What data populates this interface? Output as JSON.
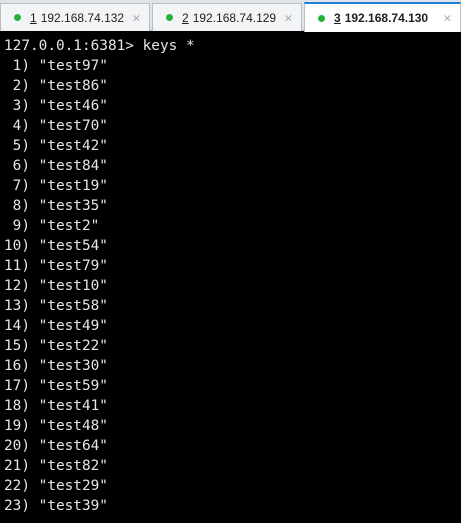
{
  "tabs": [
    {
      "number": "1",
      "label": "192.168.74.132",
      "status_color": "#22b33a",
      "active": false,
      "close": "×"
    },
    {
      "number": "2",
      "label": "192.168.74.129",
      "status_color": "#22b33a",
      "active": false,
      "close": "×"
    },
    {
      "number": "3",
      "label": "192.168.74.130",
      "status_color": "#22b33a",
      "active": true,
      "close": "×"
    }
  ],
  "terminal": {
    "prompt": "127.0.0.1:6381> keys *",
    "results": [
      " 1) \"test97\"",
      " 2) \"test86\"",
      " 3) \"test46\"",
      " 4) \"test70\"",
      " 5) \"test42\"",
      " 6) \"test84\"",
      " 7) \"test19\"",
      " 8) \"test35\"",
      " 9) \"test2\"",
      "10) \"test54\"",
      "11) \"test79\"",
      "12) \"test10\"",
      "13) \"test58\"",
      "14) \"test49\"",
      "15) \"test22\"",
      "16) \"test30\"",
      "17) \"test59\"",
      "18) \"test41\"",
      "19) \"test48\"",
      "20) \"test64\"",
      "21) \"test82\"",
      "22) \"test29\"",
      "23) \"test39\""
    ]
  },
  "colors": {
    "terminal_bg": "#000000",
    "terminal_fg": "#e6e6e6",
    "active_tab_accent": "#1e7fd6",
    "status_connected": "#22b33a"
  }
}
